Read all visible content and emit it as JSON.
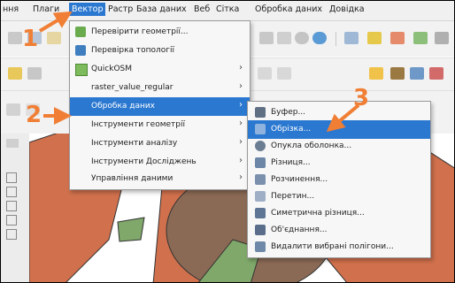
{
  "menubar": {
    "items": [
      {
        "label": "ння"
      },
      {
        "label": "Плаги"
      },
      {
        "label": "Вектор"
      },
      {
        "label": "Растр"
      },
      {
        "label": "База даних"
      },
      {
        "label": "Веб"
      },
      {
        "label": "Сітка"
      },
      {
        "label": "Обробка даних"
      },
      {
        "label": "Довідка"
      }
    ]
  },
  "vector_menu": {
    "items": [
      {
        "label": "Перевірити геометрії...",
        "icon": "check-geometry-icon",
        "submenu": false
      },
      {
        "label": "Перевірка топології",
        "icon": "topology-icon",
        "submenu": false
      },
      {
        "label": "QuickOSM",
        "icon": "quickosm-icon",
        "submenu": true
      },
      {
        "label": "raster_value_regular",
        "icon": "",
        "submenu": true
      },
      {
        "label": "Обробка даних",
        "icon": "",
        "submenu": true,
        "highlighted": true
      },
      {
        "label": "Інструменти геометрії",
        "icon": "",
        "submenu": true
      },
      {
        "label": "Інструменти аналізу",
        "icon": "",
        "submenu": true
      },
      {
        "label": "Інструменти Досліджень",
        "icon": "",
        "submenu": true
      },
      {
        "label": "Управління даними",
        "icon": "",
        "submenu": true
      }
    ]
  },
  "processing_submenu": {
    "items": [
      {
        "label": "Буфер...",
        "icon": "buffer-icon"
      },
      {
        "label": "Обрізка...",
        "icon": "clip-icon",
        "highlighted": true
      },
      {
        "label": "Опукла оболонка...",
        "icon": "convex-hull-icon"
      },
      {
        "label": "Різниця...",
        "icon": "difference-icon"
      },
      {
        "label": "Розчинення...",
        "icon": "dissolve-icon"
      },
      {
        "label": "Перетин...",
        "icon": "intersection-icon"
      },
      {
        "label": "Симетрична різниця...",
        "icon": "sym-difference-icon"
      },
      {
        "label": "Об'єднання...",
        "icon": "union-icon"
      },
      {
        "label": "Видалити вибрані полігони...",
        "icon": "eliminate-icon"
      }
    ]
  },
  "annotations": {
    "step1": "1",
    "step2": "2",
    "step3": "3",
    "color": "#f07f35"
  },
  "colors": {
    "highlight": "#2b78d0",
    "polygon_orange": "#d0704c",
    "polygon_brown": "#8a6a55",
    "polygon_green": "#7fa86a"
  }
}
